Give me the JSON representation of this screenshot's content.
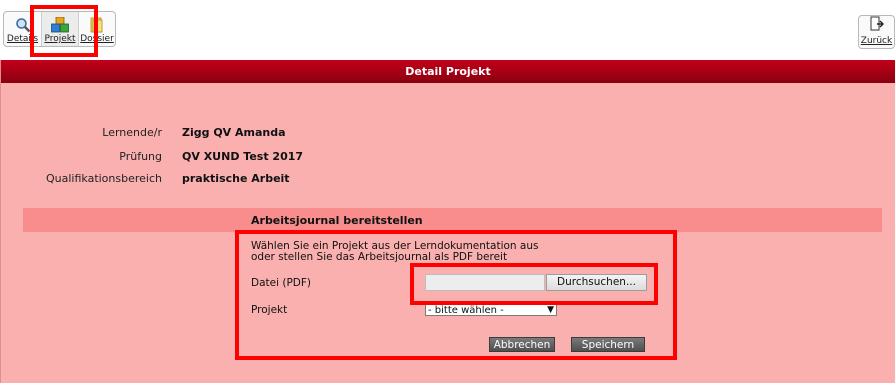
{
  "toolbar": {
    "details_label": "Details",
    "projekt_label": "Projekt",
    "dossier_label": "Dossier",
    "zurueck_label": "Zurück"
  },
  "panel": {
    "title": "Detail Projekt",
    "info": [
      {
        "label": "Lernende/r",
        "value": "Zigg QV Amanda"
      },
      {
        "label": "Prüfung",
        "value": "QV XUND Test 2017"
      },
      {
        "label": "Qualifikationsbereich",
        "value": "praktische Arbeit"
      }
    ],
    "section_title": "Arbeitsjournal bereitstellen",
    "description": "Wählen Sie ein Projekt aus der Lerndokumentation aus oder stellen Sie das Arbeitsjournal als PDF bereit",
    "file_label": "Datei (PDF)",
    "browse_label": "Durchsuchen...",
    "projekt_label": "Projekt",
    "projekt_selected": "- bitte wählen -",
    "cancel_label": "Abbrechen",
    "save_label": "Speichern"
  },
  "colors": {
    "header_red": "#a00014",
    "panel_bg": "#fbb0b0",
    "section_bg": "#f98c8c",
    "highlight": "#ff0000"
  }
}
